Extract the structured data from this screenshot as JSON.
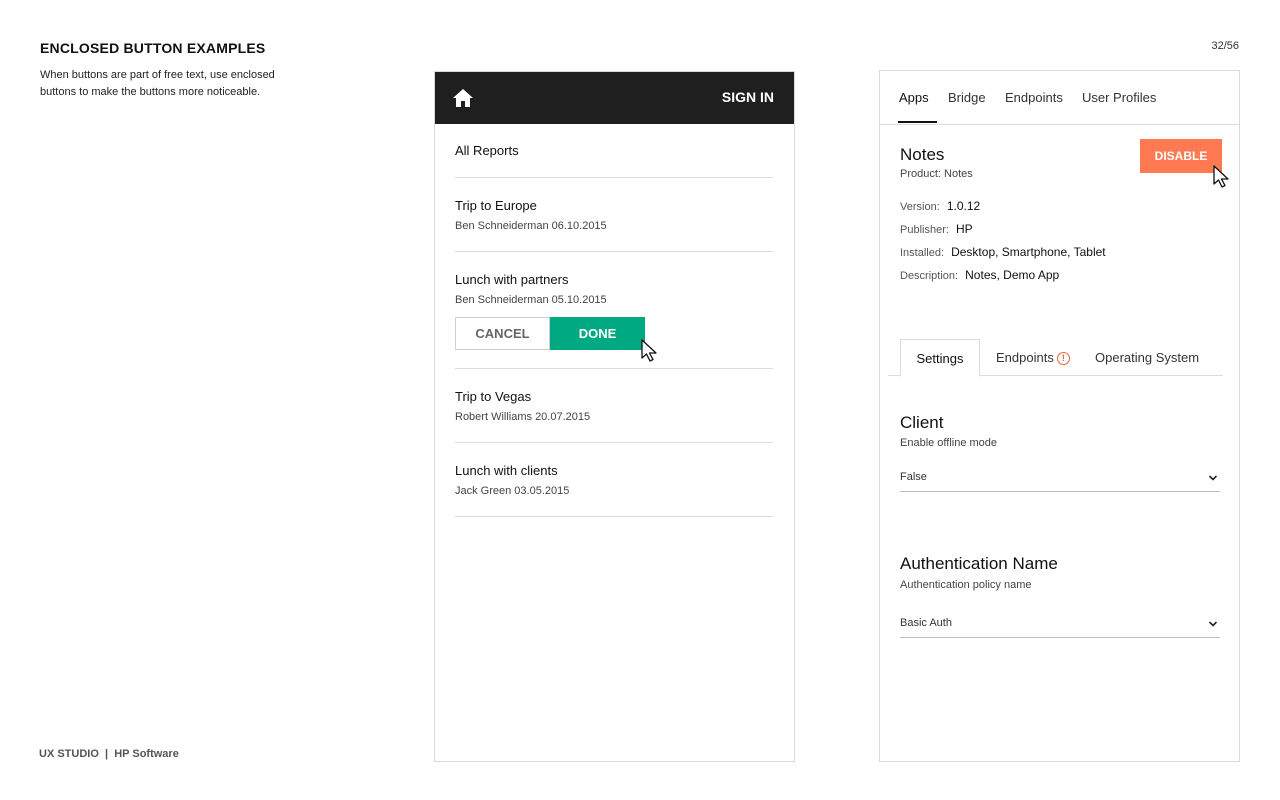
{
  "page": {
    "title": "ENCLOSED BUTTON EXAMPLES",
    "description": "When buttons are part of free text, use enclosed buttons to make the buttons more noticeable.",
    "page_number": "32/56",
    "footer_brand": "UX STUDIO",
    "footer_separator": "|",
    "footer_product": "HP Software"
  },
  "mobile": {
    "home_icon": "home-icon",
    "sign_in_label": "SIGN IN",
    "all_reports_label": "All Reports",
    "reports": [
      {
        "title": "Trip to Europe",
        "meta": "Ben Schneiderman 06.10.2015"
      },
      {
        "title": "Lunch with partners",
        "meta": "Ben Schneiderman 05.10.2015"
      },
      {
        "title": "Trip to Vegas",
        "meta": "Robert Williams  20.07.2015"
      },
      {
        "title": "Lunch with clients",
        "meta": "Jack Green  03.05.2015"
      }
    ],
    "cancel_label": "CANCEL",
    "done_label": "DONE",
    "done_color": "#01a982"
  },
  "detail": {
    "tabs": [
      "Apps",
      "Bridge",
      "Endpoints",
      "User Profiles"
    ],
    "active_tab": "Apps",
    "app_name": "Notes",
    "app_product": "Product: Notes",
    "disable_label": "DISABLE",
    "disable_color": "#ff7a52",
    "properties": [
      {
        "key": "Version:",
        "value": "1.0.12"
      },
      {
        "key": "Publisher:",
        "value": "HP"
      },
      {
        "key": "Installed:",
        "value": "Desktop, Smartphone, Tablet"
      },
      {
        "key": "Description:",
        "value": "Notes, Demo App"
      }
    ],
    "subtabs": [
      "Settings",
      "Endpoints",
      "Operating System"
    ],
    "active_subtab": "Settings",
    "endpoint_warning_icon": "warning-icon",
    "client": {
      "title": "Client",
      "subtitle": "Enable offline mode",
      "selected": "False"
    },
    "auth": {
      "title": "Authentication Name",
      "subtitle": "Authentication policy name",
      "selected": "Basic Auth"
    }
  }
}
